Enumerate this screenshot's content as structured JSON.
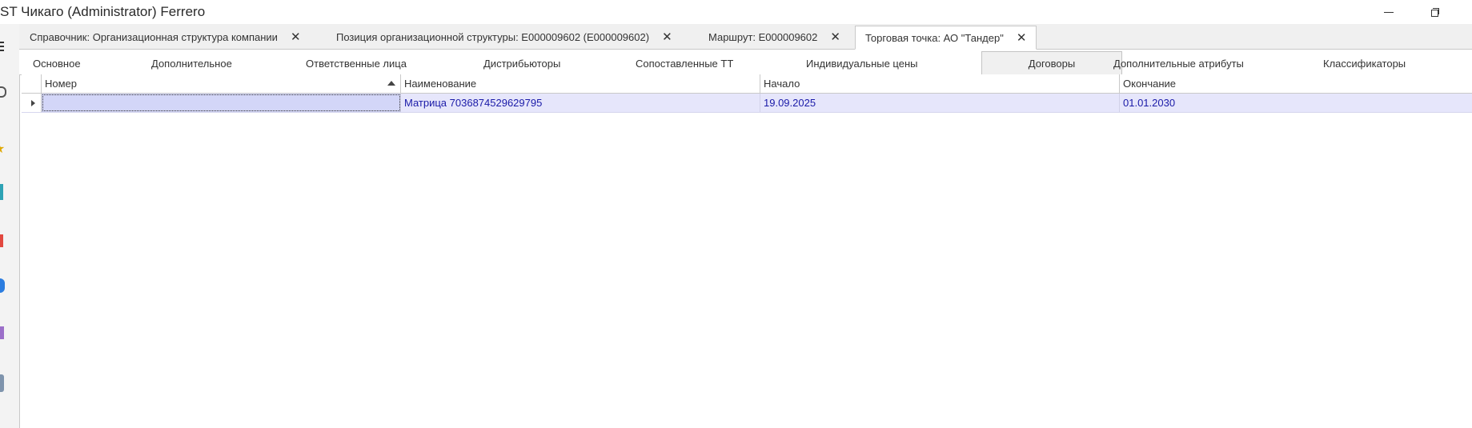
{
  "window": {
    "title": "ST Чикаго (Administrator) Ferrero"
  },
  "doc_tabs": [
    {
      "label": "Справочник: Организационная структура компании",
      "active": false
    },
    {
      "label": "Позиция организационной структуры: E000009602 (E000009602)",
      "active": false
    },
    {
      "label": "Маршрут: E000009602",
      "active": false
    },
    {
      "label": "Торговая точка: АО \"Тандер\"",
      "active": true
    }
  ],
  "content_tabs": [
    {
      "label": "Основное",
      "active": false
    },
    {
      "label": "Дополнительное",
      "active": false
    },
    {
      "label": "Ответственные лица",
      "active": false
    },
    {
      "label": "Дистрибьюторы",
      "active": false
    },
    {
      "label": "Сопоставленные ТТ",
      "active": false
    },
    {
      "label": "Индивидуальные цены",
      "active": false
    },
    {
      "label": "Договоры",
      "active": true
    },
    {
      "label": "Дополнительные атрибуты",
      "active": false
    },
    {
      "label": "Классификаторы",
      "active": false
    }
  ],
  "grid": {
    "columns": [
      "Номер",
      "Наименование",
      "Начало",
      "Окончание"
    ],
    "sorted_column": "Номер",
    "sort_direction": "ascending",
    "rows": [
      {
        "number": "",
        "name": "Матрица 7036874529629795",
        "start": "19.09.2025",
        "end": "01.01.2030"
      }
    ]
  },
  "colors": {
    "selected_row": "#e6e6fb",
    "selected_text": "#1a1aa8",
    "tab_bar": "#f0f0f0"
  }
}
